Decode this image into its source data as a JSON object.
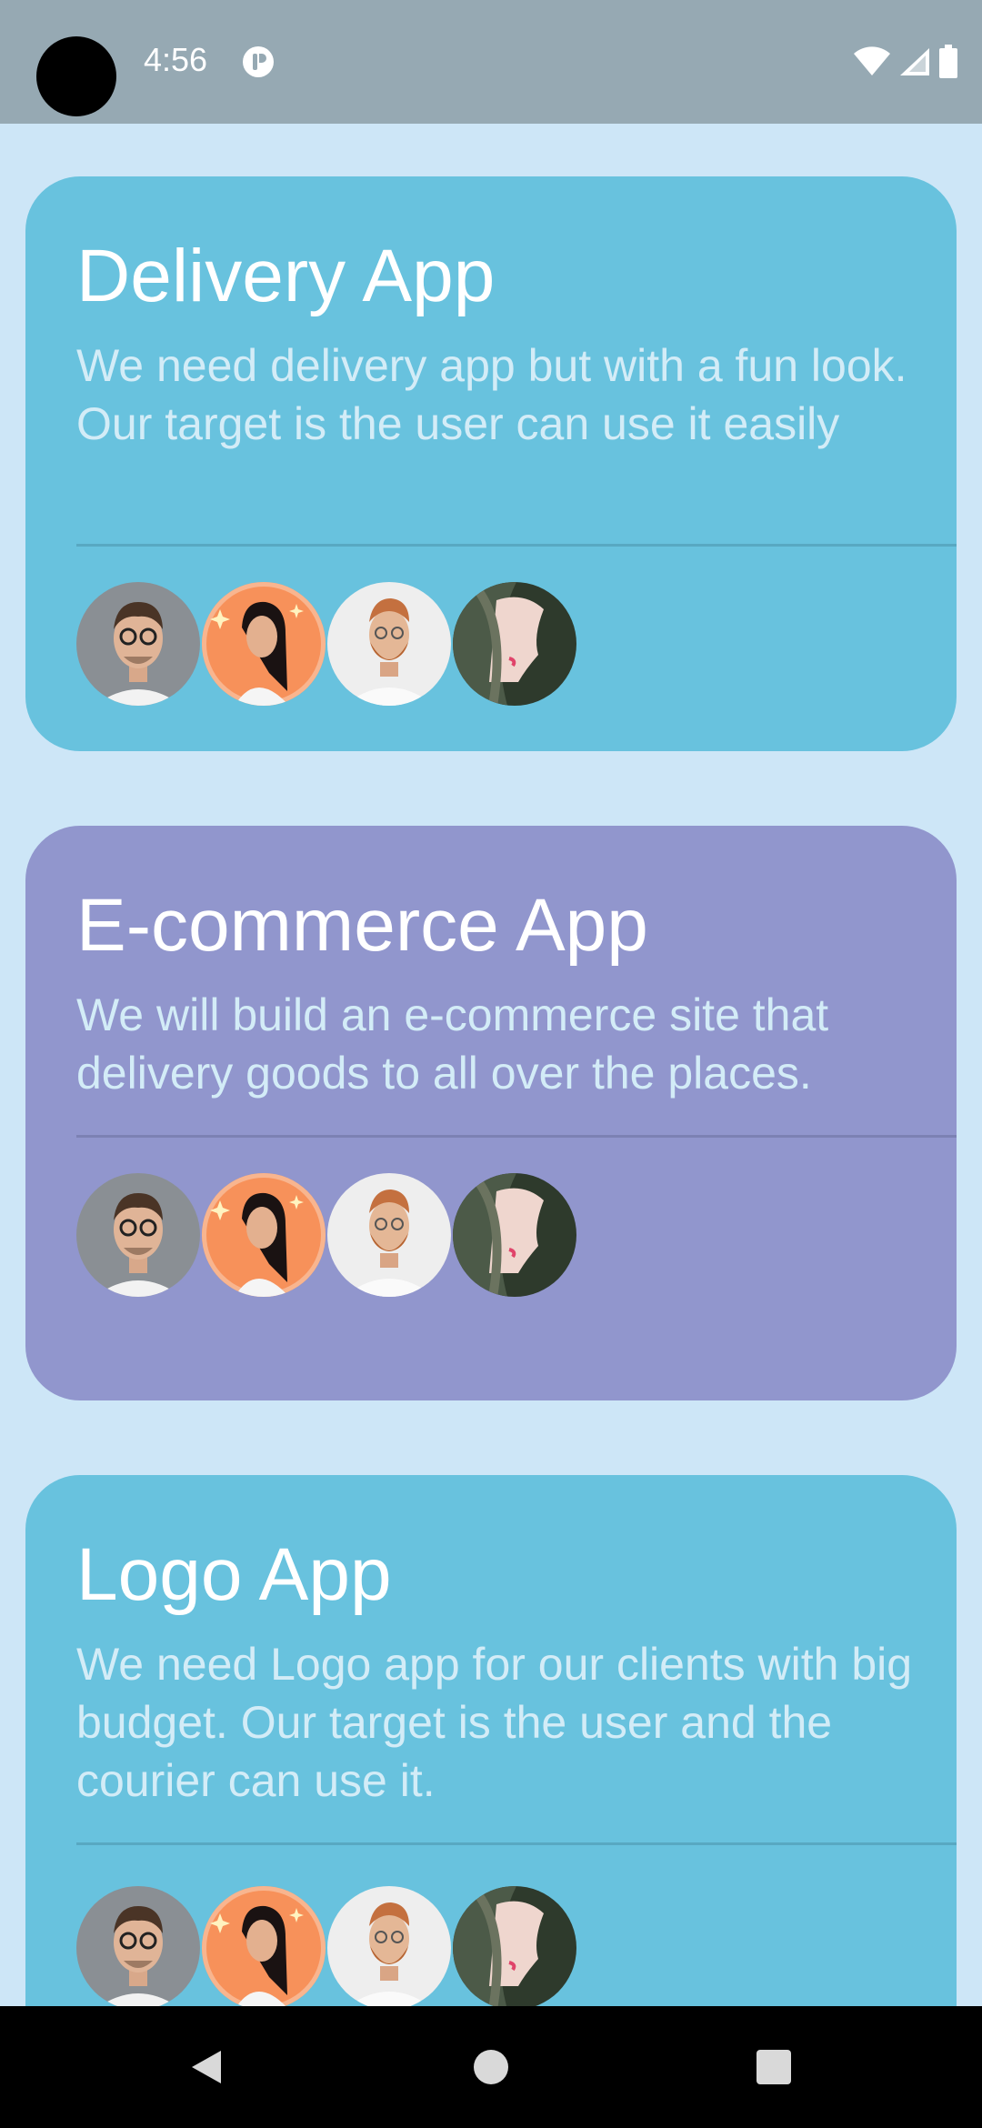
{
  "status_bar": {
    "time": "4:56",
    "icons": [
      "notification-icon",
      "wifi-icon",
      "signal-icon",
      "battery-icon"
    ]
  },
  "colors": {
    "background": "#cde6f7",
    "card_blue": "#68c2de",
    "card_purple": "#9196cd",
    "title_text": "#ffffff",
    "desc_text": "#d3ecf7"
  },
  "projects": [
    {
      "title": "Delivery App",
      "description": "We need delivery app but with a fun look. Our target is the user can use it easily",
      "color": "#68c2de",
      "members": [
        "avatar-man-glasses",
        "avatar-woman-orange",
        "avatar-man-beard",
        "avatar-woman-profile"
      ]
    },
    {
      "title": "E-commerce App",
      "description": "We will build an e-commerce site that delivery goods to all over the places.",
      "color": "#9196cd",
      "members": [
        "avatar-man-glasses",
        "avatar-woman-orange",
        "avatar-man-beard",
        "avatar-woman-profile"
      ]
    },
    {
      "title": "Logo App",
      "description": "We need Logo app for our clients with big budget. Our target is the user and the courier can use it.",
      "color": "#68c2de",
      "members": [
        "avatar-man-glasses",
        "avatar-woman-orange",
        "avatar-man-beard",
        "avatar-woman-profile"
      ]
    }
  ],
  "nav_bar": {
    "icons": [
      "back-icon",
      "home-icon",
      "recents-icon"
    ]
  }
}
